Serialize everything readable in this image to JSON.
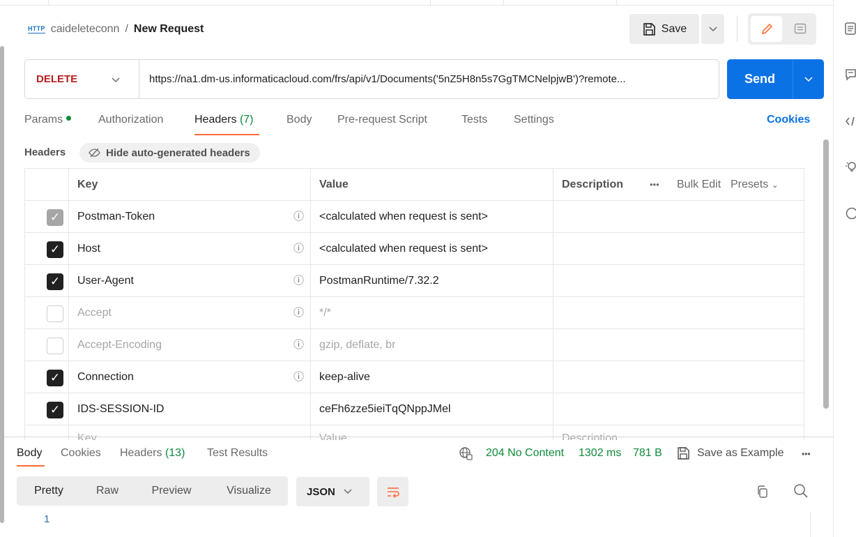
{
  "breadcrumb": {
    "protocol_badge": "HTTP",
    "collection": "caideleteconn",
    "separator": "/",
    "request_name": "New Request"
  },
  "toolbar": {
    "save_label": "Save"
  },
  "request": {
    "method": "DELETE",
    "url": "https://na1.dm-us.informaticacloud.com/frs/api/v1/Documents('5nZ5H8n5s7GgTMCNelpjwB')?remote...",
    "send_label": "Send"
  },
  "request_tabs": [
    {
      "label": "Params",
      "count": ""
    },
    {
      "label": "Authorization",
      "count": ""
    },
    {
      "label": "Headers",
      "count": "(7)"
    },
    {
      "label": "Body",
      "count": ""
    },
    {
      "label": "Pre-request Script",
      "count": ""
    },
    {
      "label": "Tests",
      "count": ""
    },
    {
      "label": "Settings",
      "count": ""
    }
  ],
  "cookies_label": "Cookies",
  "headers_section": {
    "label": "Headers",
    "toggle_label": "Hide auto-generated headers",
    "columns": {
      "key": "Key",
      "value": "Value",
      "description": "Description",
      "more": "•••",
      "bulk_edit": "Bulk Edit",
      "presets": "Presets"
    },
    "rows": [
      {
        "key": "Postman-Token",
        "value": "<calculated when request is sent>",
        "state": "auto",
        "info": true
      },
      {
        "key": "Host",
        "value": "<calculated when request is sent>",
        "state": "on",
        "info": true
      },
      {
        "key": "User-Agent",
        "value": "PostmanRuntime/7.32.2",
        "state": "on",
        "info": true
      },
      {
        "key": "Accept",
        "value": "*/*",
        "state": "off",
        "info": true
      },
      {
        "key": "Accept-Encoding",
        "value": "gzip, deflate, br",
        "state": "off",
        "info": true
      },
      {
        "key": "Connection",
        "value": "keep-alive",
        "state": "on",
        "info": true
      },
      {
        "key": "IDS-SESSION-ID",
        "value": "ceFh6zze5ieiTqQNppJMel",
        "state": "on",
        "info": false
      }
    ],
    "placeholder_row": {
      "key": "Key",
      "value": "Value",
      "description": "Description"
    }
  },
  "response": {
    "tabs": [
      {
        "label": "Body",
        "count": ""
      },
      {
        "label": "Cookies",
        "count": ""
      },
      {
        "label": "Headers",
        "count": "(13)"
      },
      {
        "label": "Test Results",
        "count": ""
      }
    ],
    "status": "204 No Content",
    "time": "1302 ms",
    "size": "781 B",
    "save_example": "Save as Example",
    "more": "•••",
    "formats": [
      "Pretty",
      "Raw",
      "Preview",
      "Visualize"
    ],
    "language": "JSON",
    "line_number": "1"
  },
  "icons": {
    "check": "✓",
    "info": "ⓘ",
    "caret": "⌄"
  },
  "colors": {
    "accent_orange": "#ff6c37",
    "send_blue": "#0b72e5",
    "method_red": "#b91d1d",
    "status_green": "#0f8a3b"
  }
}
